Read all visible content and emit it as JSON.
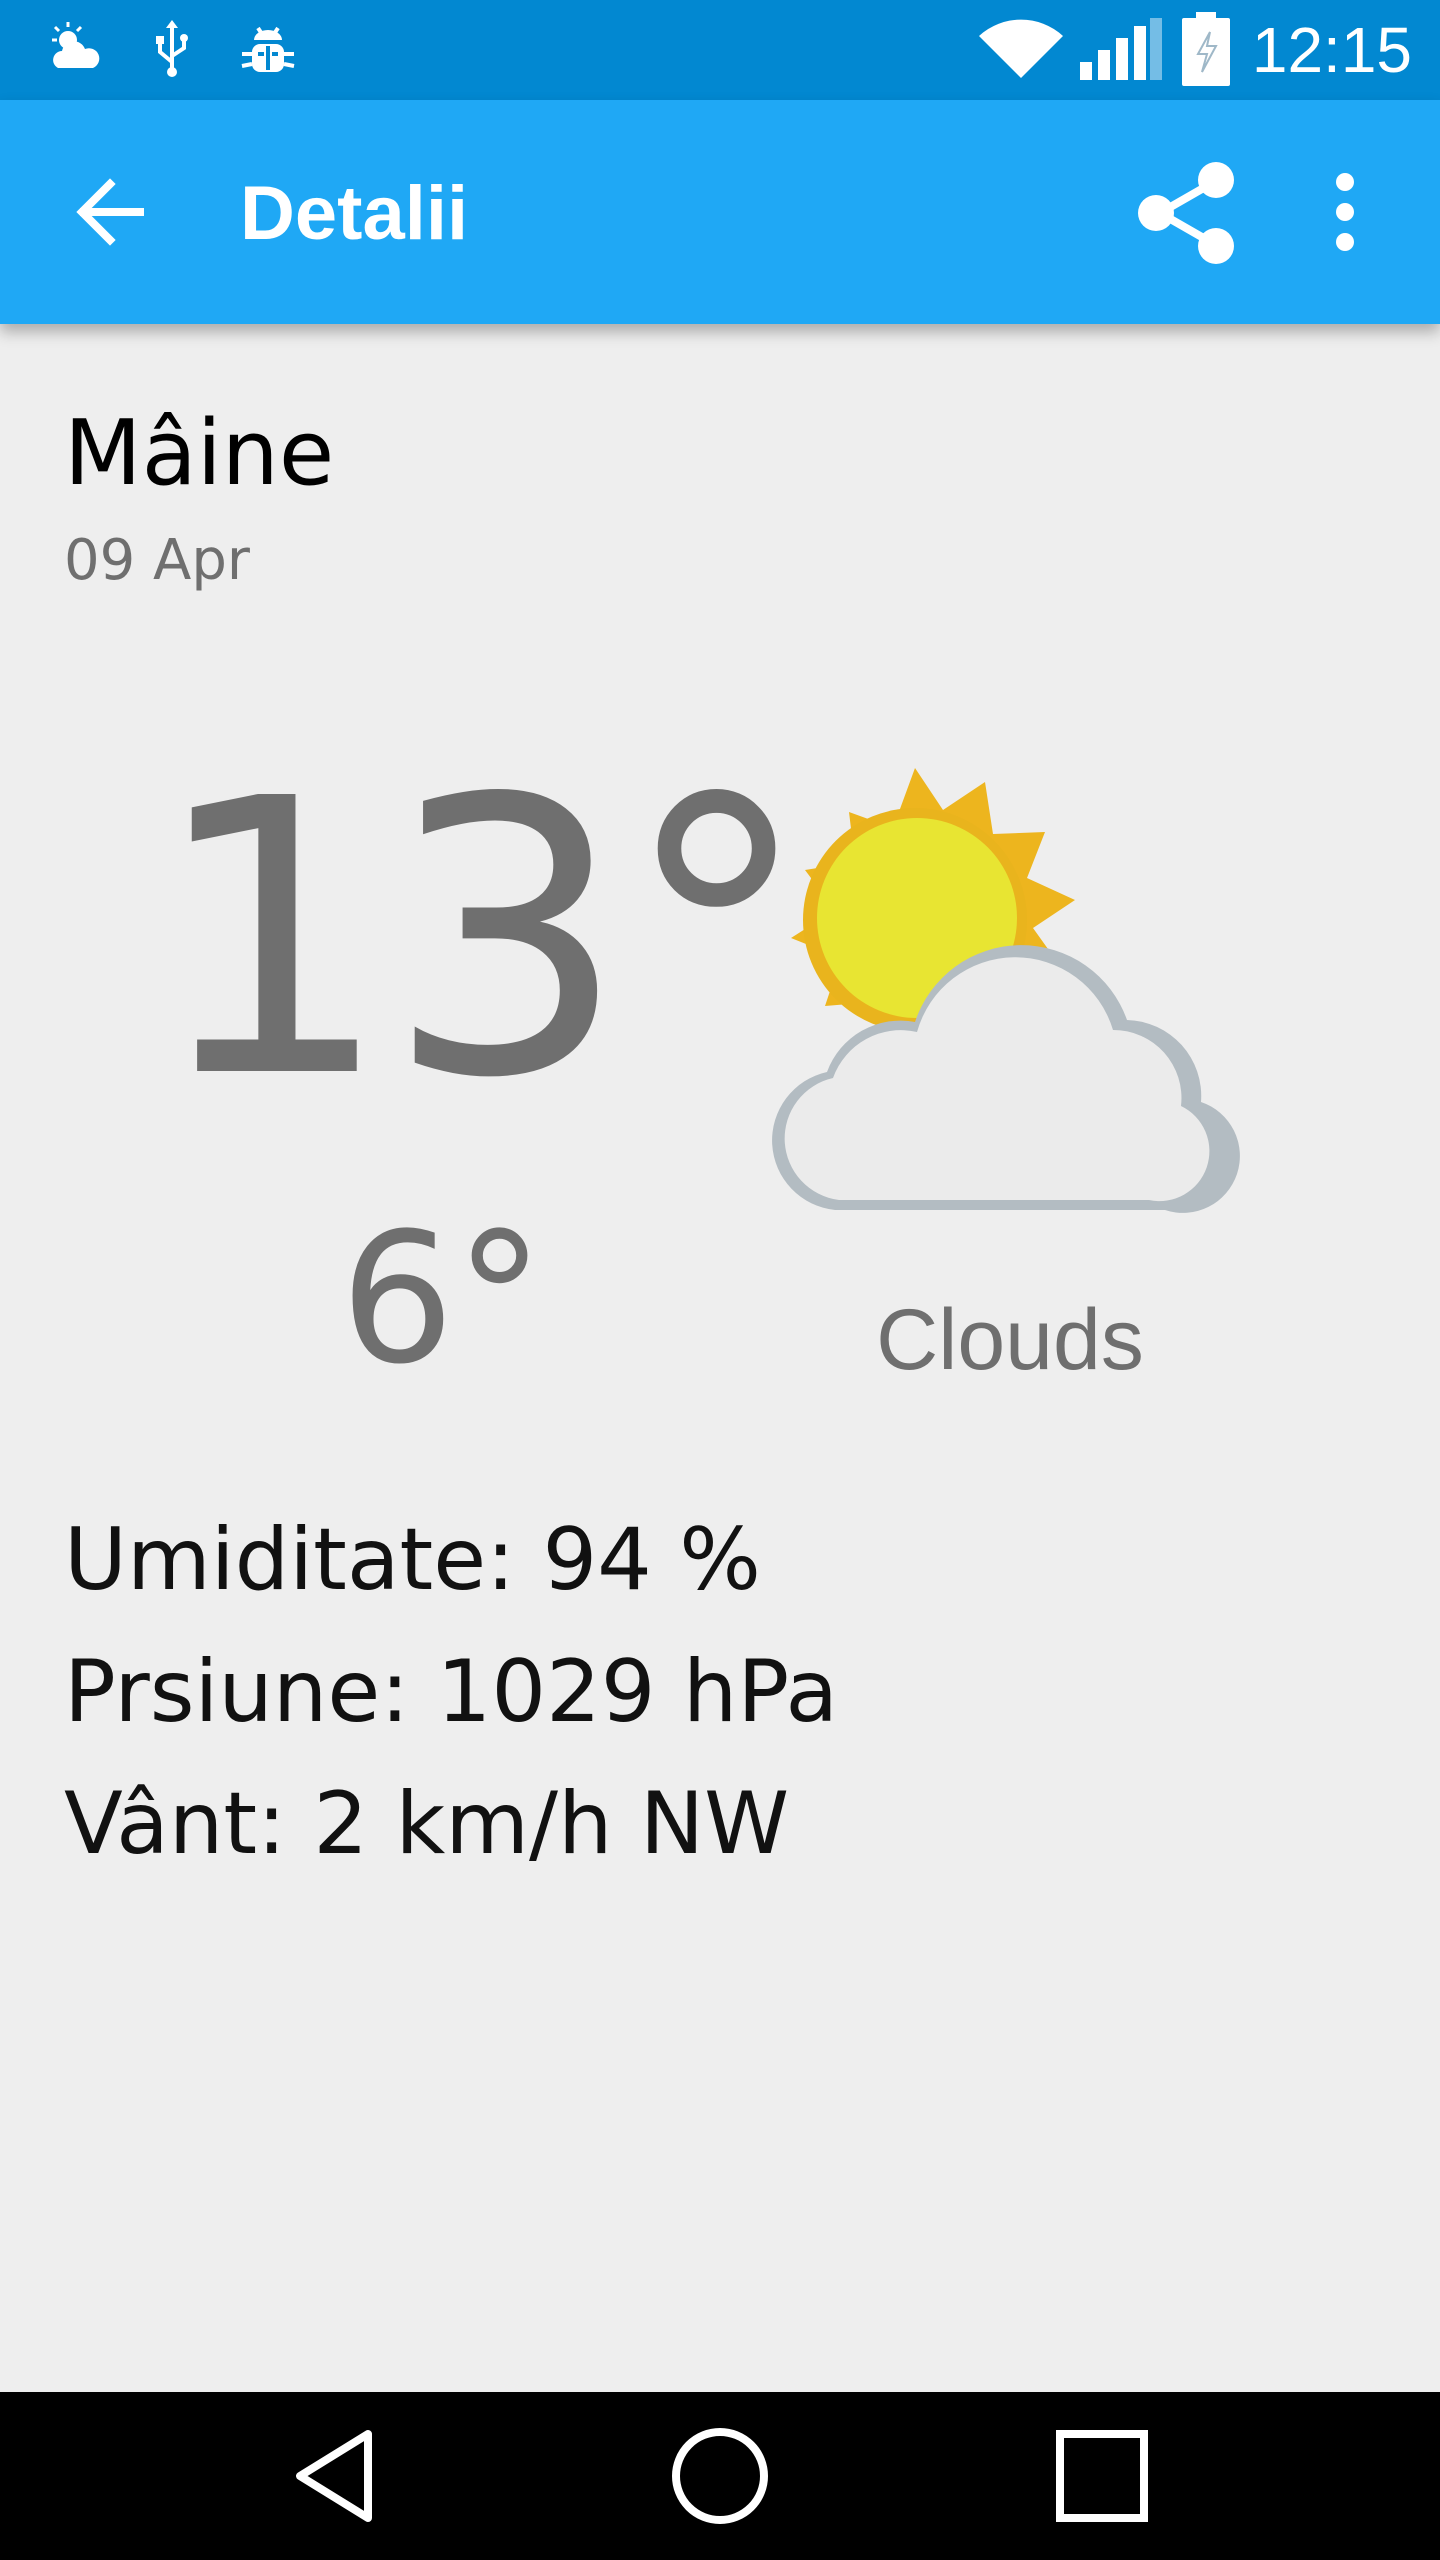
{
  "status_bar": {
    "time": "12:15",
    "icons": [
      "weather-notification-icon",
      "usb-icon",
      "debug-bug-icon",
      "wifi-icon",
      "cell-signal-icon",
      "battery-charging-icon"
    ]
  },
  "app_bar": {
    "title": "Detalii",
    "back_icon": "arrow-back-icon",
    "share_icon": "share-icon",
    "more_icon": "more-vert-icon"
  },
  "forecast": {
    "day": "Mâine",
    "date": "09 Apr",
    "high": "13°",
    "low": "6°",
    "condition": "Clouds",
    "icon": "partly-cloudy-icon"
  },
  "details": {
    "humidity": "Umiditate: 94 %",
    "pressure": "Prsiune: 1029 hPa",
    "wind": "Vânt: 2 km/h NW"
  },
  "nav_bar": {
    "icons": [
      "nav-back-icon",
      "nav-home-icon",
      "nav-recents-icon"
    ]
  },
  "colors": {
    "status_bar": "#0288D1",
    "app_bar": "#1FA8F5",
    "background": "#EEEEEE",
    "secondary_text": "#6F6F6F"
  }
}
